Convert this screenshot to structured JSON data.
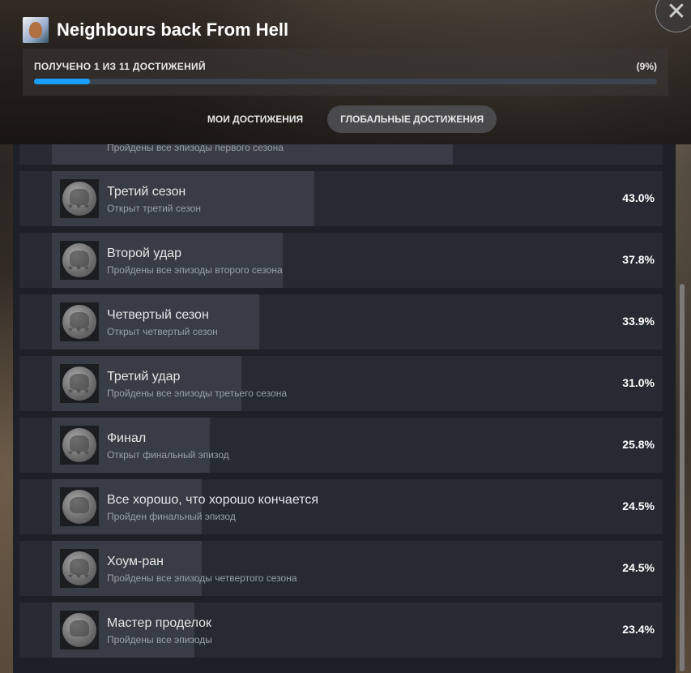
{
  "header": {
    "title": "Neighbours back From Hell",
    "close_icon": "close-icon"
  },
  "progress": {
    "label": "ПОЛУЧЕНО 1 ИЗ 11 ДОСТИЖЕНИЙ",
    "percent_text": "(9%)",
    "fraction": 0.09,
    "fill_color": "#1a9fff"
  },
  "tabs": [
    {
      "label": "МОИ ДОСТИЖЕНИЯ",
      "active": false
    },
    {
      "label": "ГЛОБАЛЬНЫЕ ДОСТИЖЕНИЯ",
      "active": true
    }
  ],
  "partial_row": {
    "desc": "Пройдены все эпизоды первого сезона"
  },
  "achievements": [
    {
      "name": "Третий сезон",
      "desc": "Открыт третий сезон",
      "pct": "43.0%",
      "value": 43.0,
      "stars": true
    },
    {
      "name": "Второй удар",
      "desc": "Пройдены все эпизоды второго сезона",
      "pct": "37.8%",
      "value": 37.8,
      "stars": true
    },
    {
      "name": "Четвертый сезон",
      "desc": "Открыт четвертый сезон",
      "pct": "33.9%",
      "value": 33.9,
      "stars": true
    },
    {
      "name": "Третий удар",
      "desc": "Пройдены все эпизоды третьего сезона",
      "pct": "31.0%",
      "value": 31.0,
      "stars": true
    },
    {
      "name": "Финал",
      "desc": "Открыт финальный эпизод",
      "pct": "25.8%",
      "value": 25.8,
      "stars": true
    },
    {
      "name": "Все хорошо, что хорошо кончается",
      "desc": "Пройден финальный эпизод",
      "pct": "24.5%",
      "value": 24.5,
      "stars": false
    },
    {
      "name": "Хоум-ран",
      "desc": "Пройдены все эпизоды четвертого сезона",
      "pct": "24.5%",
      "value": 24.5,
      "stars": true
    },
    {
      "name": "Мастер проделок",
      "desc": "Пройдены все эпизоды",
      "pct": "23.4%",
      "value": 23.4,
      "stars": false
    }
  ]
}
